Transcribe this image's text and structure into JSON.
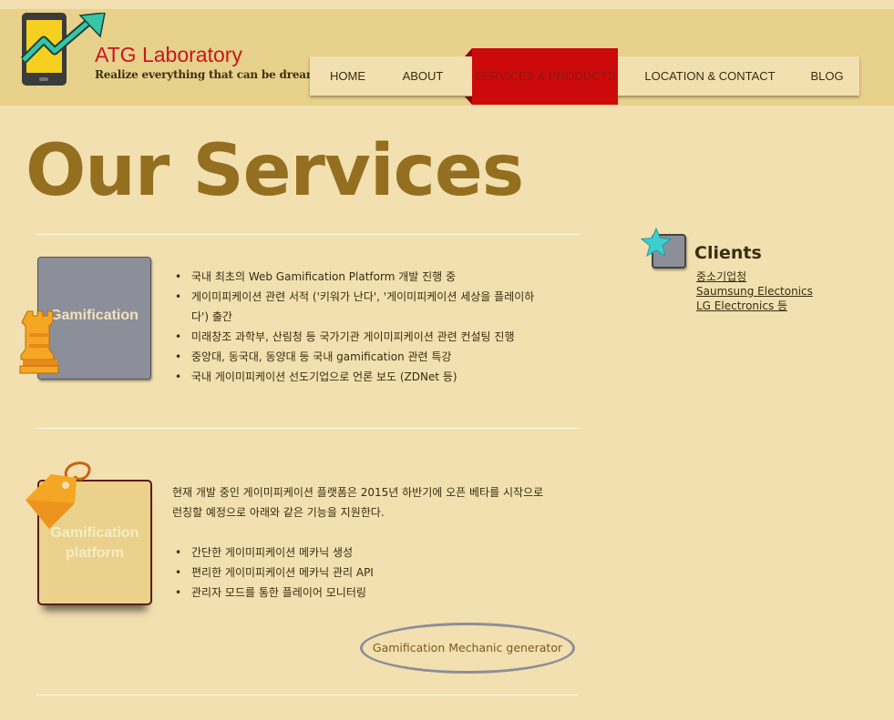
{
  "brand": {
    "title": "ATG Laboratory",
    "tagline": "Realize everything that can be dreamed"
  },
  "nav": [
    {
      "label": "HOME",
      "active": false
    },
    {
      "label": "ABOUT",
      "active": false
    },
    {
      "label": "SERVICES & PRODUCTS",
      "active": true
    },
    {
      "label": "LOCATION & CONTACT",
      "active": false
    },
    {
      "label": "BLOG",
      "active": false
    }
  ],
  "page_title": "Our Services",
  "services": [
    {
      "box_label": "Gamification",
      "icon": "chess-rook-icon",
      "bullets": [
        "국내 최초의 Web Gamification Platform 개발 진행 중",
        "게이미피케이션 관련 서적 ('키워가 난다', '게이미피케이션 세상을 플레이하",
        "다') 출간",
        "미래창조 과학부, 산림청 등 국가기관 게이미피케이션 관련 컨설팅 진행",
        "중앙대, 동국대, 동양대 등 국내 gamification 관련 특강",
        "국내 게이미피케이션 선도기업으로 언론 보도 (ZDNet 등)"
      ]
    },
    {
      "box_label_line1": "Gamification",
      "box_label_line2": "platform",
      "icon": "price-tag-icon",
      "paragraph_line1": "현재 개발 중인 게이미피케이션 플랫폼은 2015년 하반기에 오픈 베타를 시작으로",
      "paragraph_line2": "런칭할 예정으로 아래와 같은 기능을 지원한다.",
      "bullets": [
        "간단한 게이미피케이션 메카닉 생성",
        "편리한 게이미피케이션 메카닉 관리 API",
        "관리자 모드를 통한 플레이어 모니터링"
      ],
      "cta_label": "Gamification Mechanic generator"
    }
  ],
  "clients": {
    "title": "Clients",
    "icon": "star-icon",
    "items": [
      "중소기업청",
      "Saumsung Electonics",
      "LG Electronics 등"
    ]
  },
  "colors": {
    "page_bg": "#f2e0b1",
    "header_bg": "#e8d18b",
    "brand_red": "#c8161d",
    "nav_active": "#cc0a0a",
    "title_brown": "#946f1f",
    "box_gray": "#8c8f99"
  }
}
